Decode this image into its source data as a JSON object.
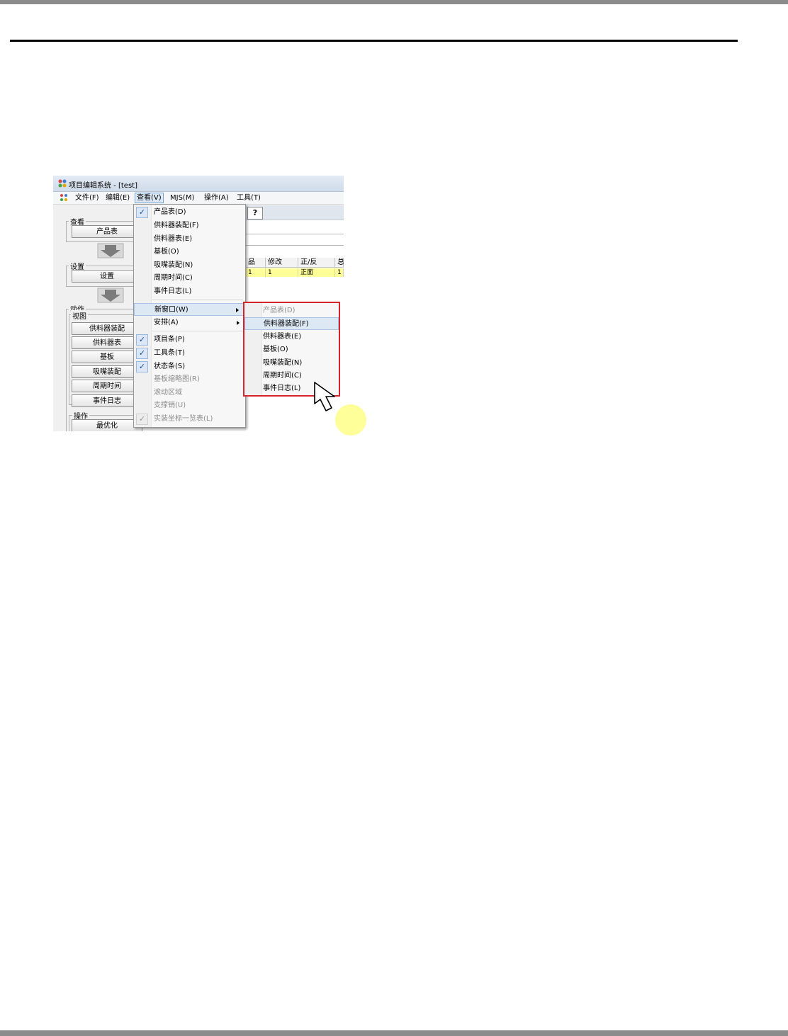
{
  "window": {
    "title": "项目编辑系统 - [test]"
  },
  "menubar": {
    "items": [
      "文件(F)",
      "编辑(E)",
      "查看(V)",
      "MJS(M)",
      "操作(A)",
      "工具(T)"
    ],
    "open_item": "查看(V)"
  },
  "left_panel": {
    "view_group": {
      "title": "查看",
      "button": "产品表"
    },
    "setup_group": {
      "title": "设置",
      "button": "设置"
    },
    "action_group": {
      "title": "动作",
      "sub_title": "视图",
      "buttons": [
        "供料器装配",
        "供料器表",
        "基板",
        "吸嘴装配",
        "周期时间",
        "事件日志"
      ]
    },
    "operation_group": {
      "title": "操作",
      "button": "最优化"
    }
  },
  "grid": {
    "headers": [
      "品",
      "修改",
      "正/反",
      "总"
    ],
    "row": [
      "1",
      "1",
      "正面",
      "1"
    ]
  },
  "view_menu": {
    "items": [
      {
        "label": "产品表(D)",
        "checked": true
      },
      {
        "label": "供料器装配(F)"
      },
      {
        "label": "供料器表(E)"
      },
      {
        "label": "基板(O)"
      },
      {
        "label": "吸嘴装配(N)"
      },
      {
        "label": "周期时间(C)"
      },
      {
        "label": "事件日志(L)"
      },
      {
        "label": "新窗口(W)",
        "submenu": true,
        "highlighted": true
      },
      {
        "label": "安排(A)",
        "submenu": true
      },
      {
        "label": "项目条(P)",
        "checked": true
      },
      {
        "label": "工具条(T)",
        "checked": true
      },
      {
        "label": "状态条(S)",
        "checked": true
      },
      {
        "label": "基板缩略图(R)",
        "disabled": true
      },
      {
        "label": "滚动区域",
        "disabled": true
      },
      {
        "label": "支撑销(U)",
        "disabled": true
      },
      {
        "label": "实装坐标一览表(L)",
        "disabled": true,
        "checked": true
      }
    ]
  },
  "new_window_submenu": {
    "items": [
      {
        "label": "产品表(D)",
        "disabled": true
      },
      {
        "label": "供料器装配(F)",
        "highlighted": true
      },
      {
        "label": "供料器表(E)"
      },
      {
        "label": "基板(O)"
      },
      {
        "label": "吸嘴装配(N)"
      },
      {
        "label": "周期时间(C)"
      },
      {
        "label": "事件日志(L)"
      }
    ]
  },
  "colors": {
    "callout_border": "#d9232a",
    "highlight": "#dde8f5",
    "check_color": "#1b4fa0",
    "grid_row_bg": "#ffff99",
    "cursor_halo": "#ffff99"
  },
  "icons": [
    "app-icon",
    "mdi-child-icon",
    "help-icon",
    "check-icon",
    "submenu-arrow-icon",
    "down-arrow-icon",
    "mouse-pointer-icon"
  ]
}
